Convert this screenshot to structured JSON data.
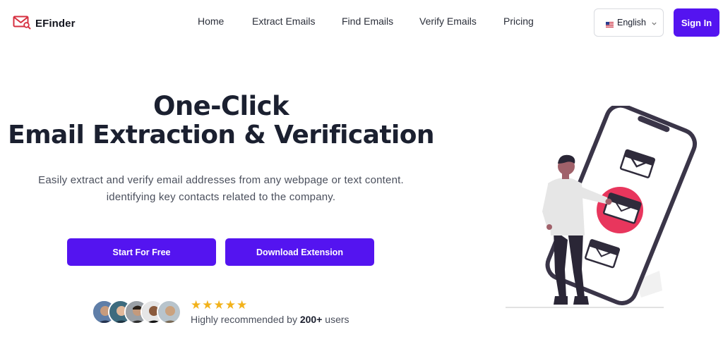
{
  "brand": {
    "name": "EFinder",
    "accent": "#5414f0",
    "logo_color": "#d63040"
  },
  "nav": {
    "items": [
      {
        "label": "Home"
      },
      {
        "label": "Extract Emails"
      },
      {
        "label": "Find Emails"
      },
      {
        "label": "Verify Emails"
      },
      {
        "label": "Pricing"
      }
    ]
  },
  "language": {
    "selected": "English",
    "flag": "us-flag-icon"
  },
  "header": {
    "signin_label": "Sign In"
  },
  "hero": {
    "title_line1": "One-Click",
    "title_line2": "Email Extraction & Verification",
    "subtitle_line1": "Easily extract and verify email addresses from any webpage or text content.",
    "subtitle_line2": "identifying key contacts related to the company.",
    "cta_primary": "Start For Free",
    "cta_secondary": "Download Extension"
  },
  "social_proof": {
    "stars": "★★★★★",
    "rating": 5,
    "text_prefix": "Highly recommended by ",
    "count": "200+",
    "text_suffix": " users"
  }
}
